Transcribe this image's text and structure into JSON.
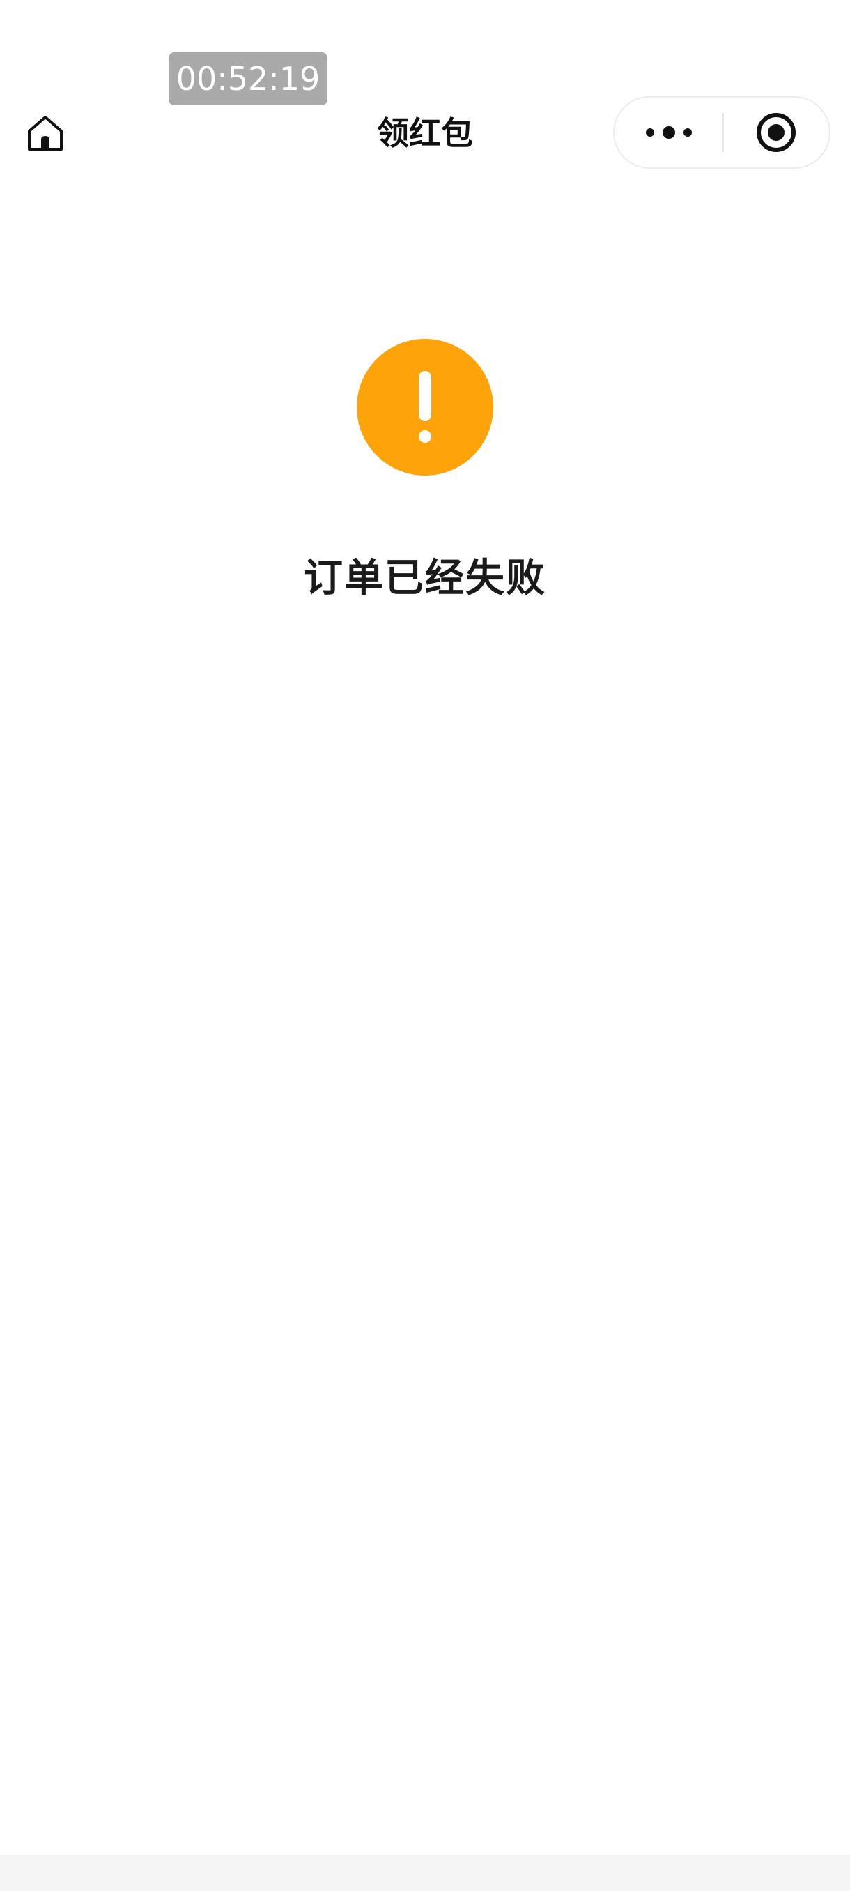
{
  "timer": {
    "text": "00:52:19"
  },
  "nav": {
    "title": "领红包",
    "home_icon": "home-icon",
    "more_icon": "more-dots-icon",
    "close_icon": "record-circle-icon"
  },
  "status": {
    "icon": "warning-exclamation-icon",
    "icon_color": "#FFA30A",
    "message": "订单已经失败"
  }
}
